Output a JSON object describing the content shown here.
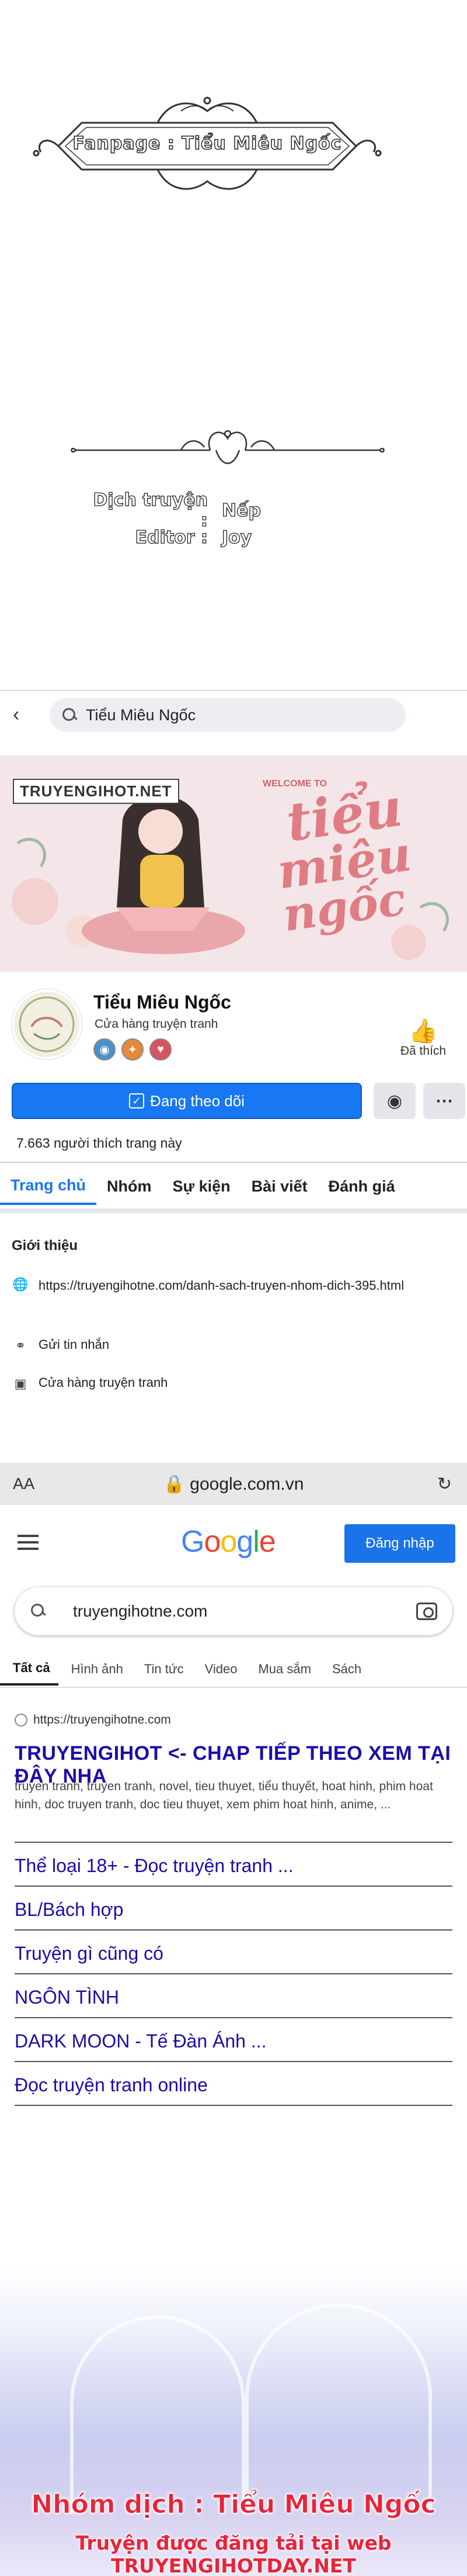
{
  "credits": {
    "fanpage": "Fanpage : Tiểu Miêu Ngốc",
    "translator_label": "Dịch truyện :",
    "translator": "Nếp",
    "editor_label": "Editor :",
    "editor": "Joy"
  },
  "facebook": {
    "search_text": "Tiểu Miêu Ngốc",
    "cover_label": "TRUYENGIHOT.NET",
    "cover_small": "WELCOME TO",
    "cover_title_l1": "tiểu",
    "cover_title_l2": "miêu",
    "cover_title_l3": "ngốc",
    "page_name": "Tiểu Miêu Ngốc",
    "page_category": "Cửa hàng truyện tranh",
    "like_label": "Đã thích",
    "follow_label": "Đang theo dõi",
    "likes_count": "7.663 người thích trang này",
    "tabs": [
      "Trang chủ",
      "Nhóm",
      "Sự kiện",
      "Bài viết",
      "Đánh giá"
    ],
    "intro_title": "Giới thiệu",
    "intro_link": "https://truyengihotne.com/danh-sach-truyen-nhom-dich-395.html",
    "intro_message": "Gửi tin nhắn",
    "intro_shop": "Cửa hàng truyện tranh",
    "address_aa": "AA",
    "address_url": "google.com.vn"
  },
  "google": {
    "logo": "Google",
    "signin": "Đăng nhập",
    "query": "truyengihotne.com",
    "tabs": [
      "Tất cả",
      "Hình ảnh",
      "Tin tức",
      "Video",
      "Mua sắm",
      "Sách"
    ],
    "result_url": "https://truyengihotne.com",
    "result_title": "TRUYENGIHOT <- CHAP TIẾP THEO XEM TẠI ĐÂY NHA",
    "result_snippet": "truyen tranh, truyen tranh, novel, tieu thuyet, tiểu thuyết, hoat hinh, phim hoat hinh, doc truyen tranh, doc tieu thuyet, xem phim hoat hinh, anime, ...",
    "sitelinks": [
      "Thể loại 18+ - Đọc truyện tranh ...",
      "BL/Bách hợp",
      "Truyện gì cũng có",
      "NGÔN TÌNH",
      "DARK MOON - Tế Đàn Ánh ...",
      "Đọc truyện tranh online"
    ]
  },
  "footer": {
    "line1": "Nhóm dịch : Tiểu Miêu Ngốc",
    "line2": "Truyện được đăng tải tại web TRUYENGIHOTDAY.NET"
  },
  "colors": {
    "facebook_blue": "#1877f2",
    "google_blue": "#1a73e8",
    "link_blue": "#1a0dab",
    "footer_red": "#e8243a",
    "cover_pink": "#e07c83"
  }
}
